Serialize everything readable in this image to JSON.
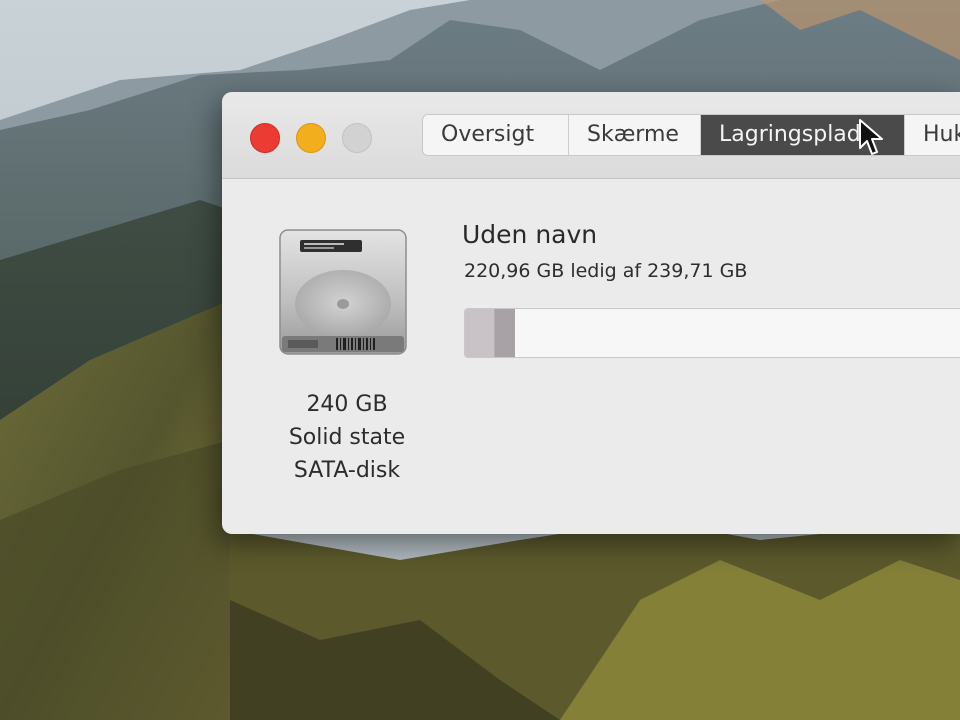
{
  "window": {
    "tabs": [
      {
        "label": "Oversigt",
        "selected": false
      },
      {
        "label": "Skærme",
        "selected": false
      },
      {
        "label": "Lagringsplads",
        "selected": true
      },
      {
        "label": "Huk",
        "selected": false
      }
    ]
  },
  "disk": {
    "icon": "hard-drive-icon",
    "capacity": "240 GB",
    "type": "Solid state",
    "interface": "SATA-disk"
  },
  "volume": {
    "name": "Uden navn",
    "free_text": "220,96 GB ledig af 239,71 GB",
    "used_fraction": 0.078,
    "segments": [
      {
        "fraction": 0.046,
        "color": "#c9c2c6"
      },
      {
        "fraction": 0.032,
        "color": "#a8a2a6"
      }
    ]
  },
  "colors": {
    "close": "#ec3b32",
    "minimize": "#f2ae1d",
    "zoom": "#d3d2d2",
    "selected_tab": "#4a4a4a"
  }
}
